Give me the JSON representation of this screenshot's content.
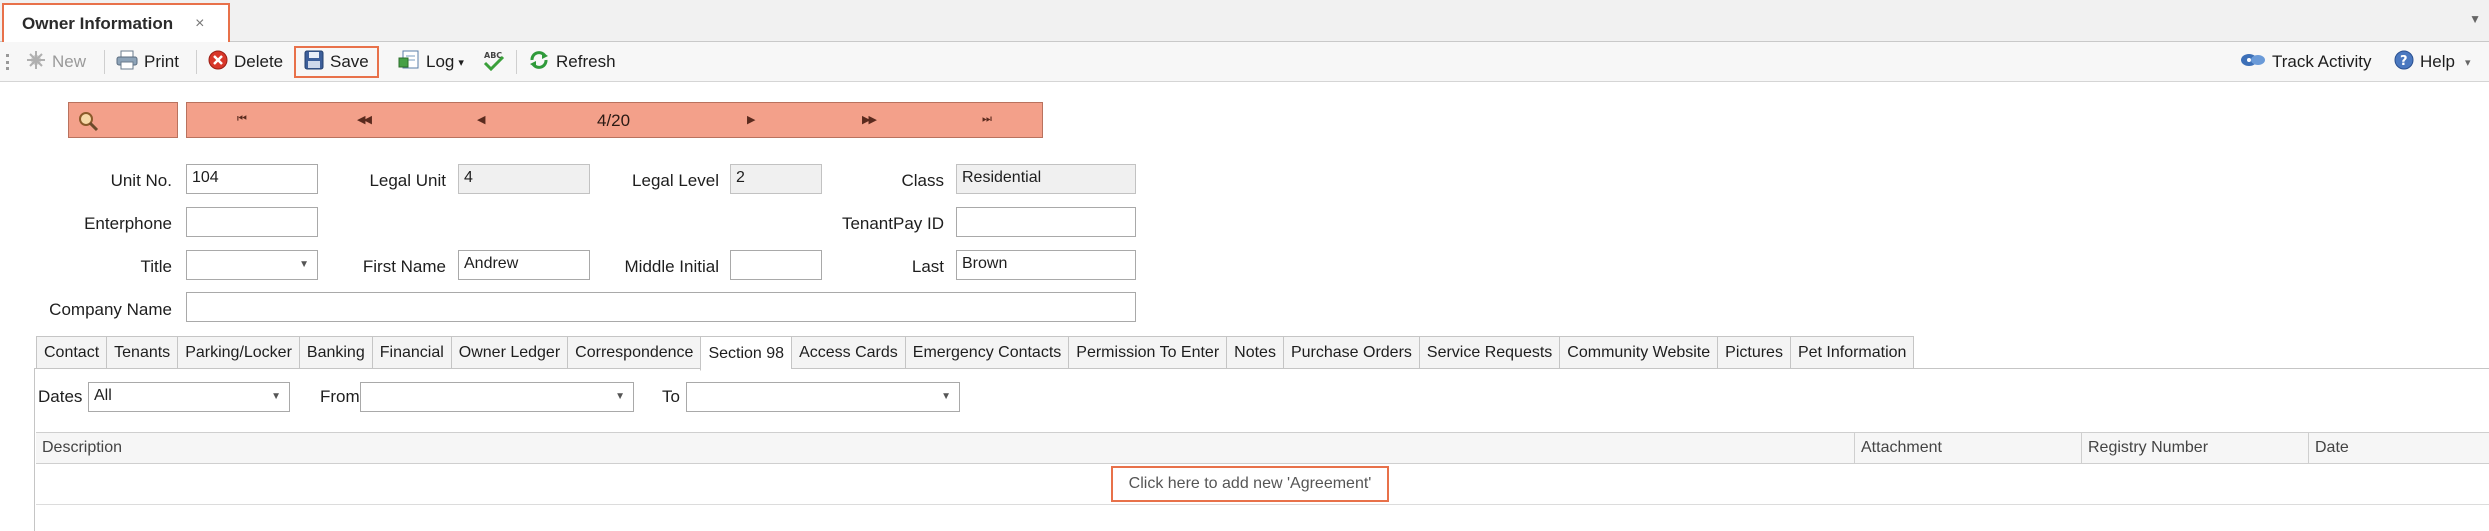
{
  "doc_tab": {
    "title": "Owner Information",
    "close": "×"
  },
  "toolbar": {
    "new": "New",
    "print": "Print",
    "delete": "Delete",
    "save": "Save",
    "log": "Log",
    "log_arrow": "▾",
    "refresh": "Refresh",
    "track_activity": "Track Activity",
    "help": "Help",
    "help_arrow": "▾"
  },
  "navigator": {
    "first": "⏮",
    "prev_page": "◀◀",
    "prev": "◀",
    "position": "4/20",
    "next": "▶",
    "next_page": "▶▶",
    "last": "⏭"
  },
  "form": {
    "unit_no": {
      "label": "Unit No.",
      "value": "104"
    },
    "legal_unit": {
      "label": "Legal Unit",
      "value": "4"
    },
    "legal_level": {
      "label": "Legal Level",
      "value": "2"
    },
    "class": {
      "label": "Class",
      "value": "Residential"
    },
    "enterphone": {
      "label": "Enterphone",
      "value": ""
    },
    "tenantpay_id": {
      "label": "TenantPay ID",
      "value": ""
    },
    "title": {
      "label": "Title",
      "value": ""
    },
    "first_name": {
      "label": "First Name",
      "value": "Andrew"
    },
    "middle_initial": {
      "label": "Middle Initial",
      "value": ""
    },
    "last": {
      "label": "Last",
      "value": "Brown"
    },
    "company_name": {
      "label": "Company Name",
      "value": ""
    }
  },
  "section_tabs": [
    "Contact",
    "Tenants",
    "Parking/Locker",
    "Banking",
    "Financial",
    "Owner Ledger",
    "Correspondence",
    "Section 98",
    "Access Cards",
    "Emergency Contacts",
    "Permission To Enter",
    "Notes",
    "Purchase Orders",
    "Service Requests",
    "Community Website",
    "Pictures",
    "Pet Information"
  ],
  "active_tab": "Section 98",
  "filters": {
    "dates": {
      "label": "Dates",
      "value": "All"
    },
    "from": {
      "label": "From",
      "value": ""
    },
    "to": {
      "label": "To",
      "value": ""
    }
  },
  "grid": {
    "columns": [
      "Description",
      "Attachment",
      "Registry Number",
      "Date"
    ],
    "new_row": "Click here to add new 'Agreement'"
  },
  "colors": {
    "accent": "#e8714a",
    "nav_fill": "#f3a08a"
  }
}
